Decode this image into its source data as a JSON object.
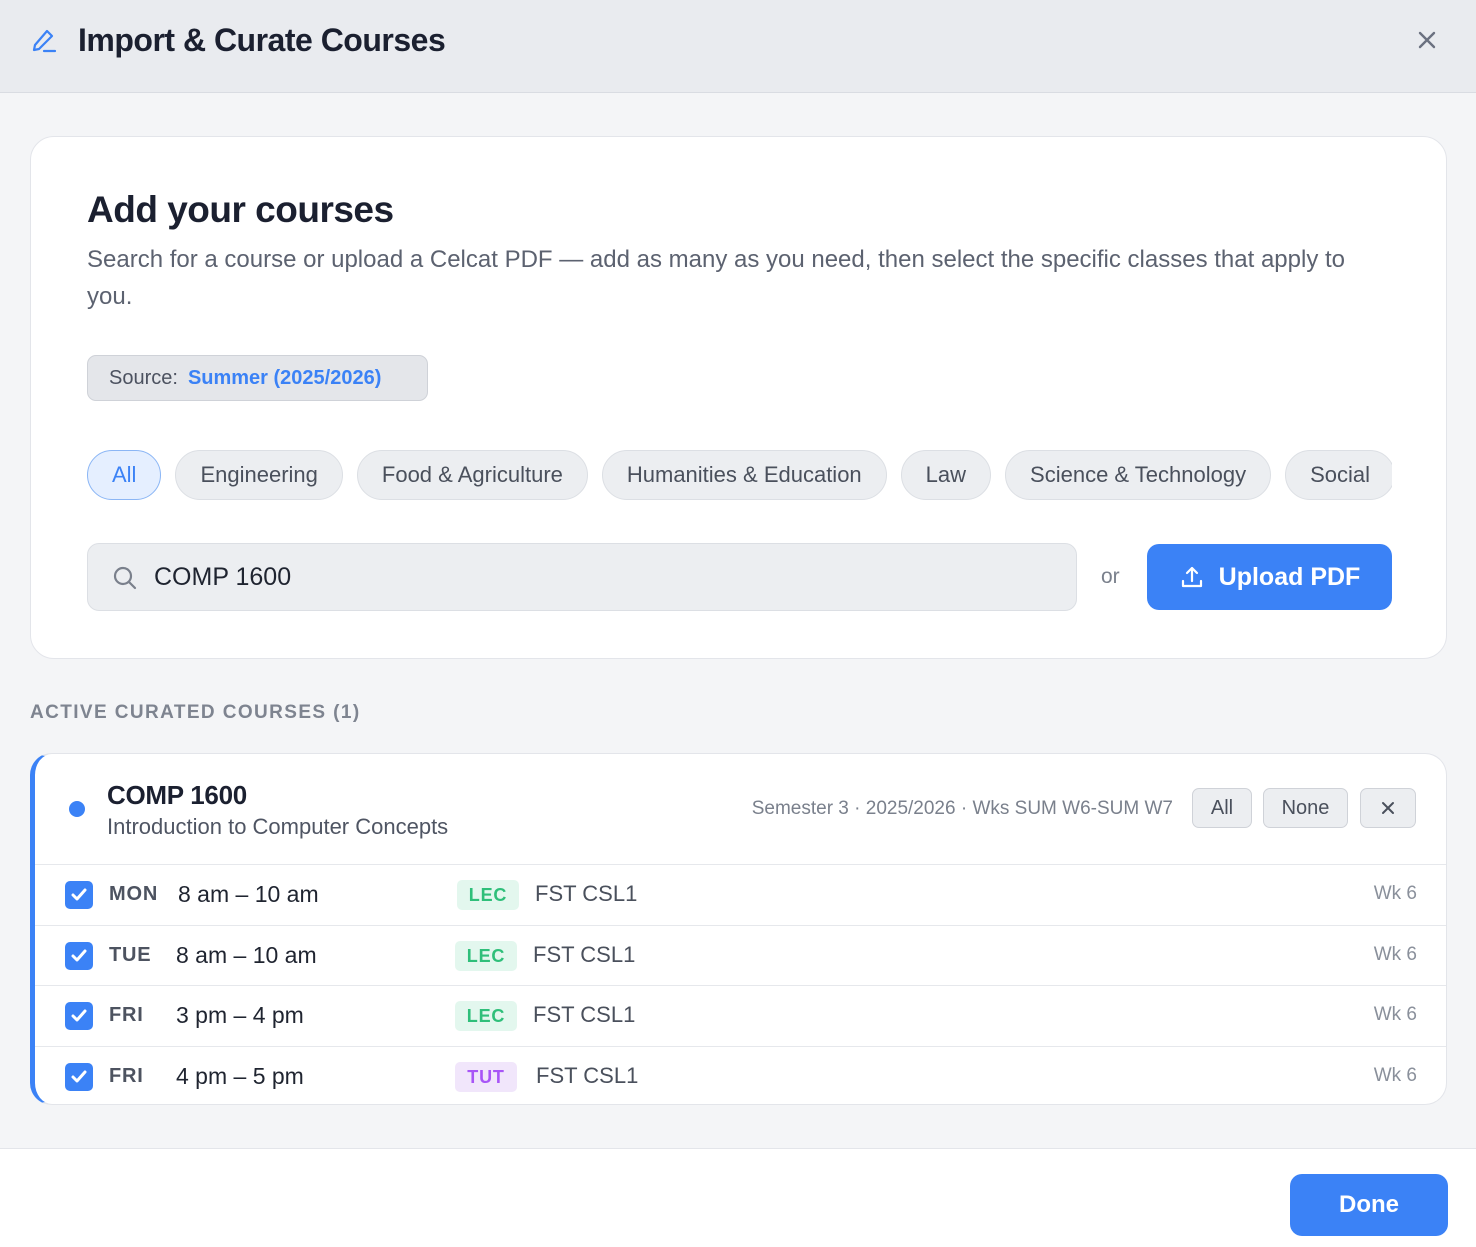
{
  "header": {
    "title": "Import & Curate Courses",
    "icons": {
      "title_icon": "pencil-icon",
      "close": "close-icon"
    }
  },
  "add_card": {
    "heading": "Add your courses",
    "description": "Search for a course or upload a Celcat PDF — add as many as you need, then select the specific classes that apply to you.",
    "source_label": "Source:",
    "source_value": "Summer (2025/2026)",
    "filters": [
      {
        "label": "All",
        "active": true
      },
      {
        "label": "Engineering",
        "active": false
      },
      {
        "label": "Food & Agriculture",
        "active": false
      },
      {
        "label": "Humanities & Education",
        "active": false
      },
      {
        "label": "Law",
        "active": false
      },
      {
        "label": "Science & Technology",
        "active": false
      },
      {
        "label": "Social",
        "active": false
      }
    ],
    "search_value": "COMP 1600",
    "or_label": "or",
    "upload_label": "Upload PDF"
  },
  "curated": {
    "section_title": "ACTIVE CURATED COURSES (1)",
    "course": {
      "code": "COMP 1600",
      "name": "Introduction to Computer Concepts",
      "meta": "Semester 3 · 2025/2026 · Wks SUM W6-SUM W7",
      "all_label": "All",
      "none_label": "None",
      "remove_label": "×",
      "classes": [
        {
          "checked": true,
          "day": "MON",
          "time": "8 am – 10 am",
          "type": "LEC",
          "room": "FST CSL1",
          "week": "Wk 6"
        },
        {
          "checked": true,
          "day": "TUE",
          "time": "8 am – 10 am",
          "type": "LEC",
          "room": "FST CSL1",
          "week": "Wk 6"
        },
        {
          "checked": true,
          "day": "FRI",
          "time": "3 pm – 4 pm",
          "type": "LEC",
          "room": "FST CSL1",
          "week": "Wk 6"
        },
        {
          "checked": true,
          "day": "FRI",
          "time": "4 pm – 5 pm",
          "type": "TUT",
          "room": "FST CSL1",
          "week": "Wk 6"
        }
      ]
    }
  },
  "footer": {
    "done_label": "Done"
  },
  "colors": {
    "accent": "#3b82f6",
    "lec": "#2fbf7a",
    "tut": "#a855f7"
  }
}
